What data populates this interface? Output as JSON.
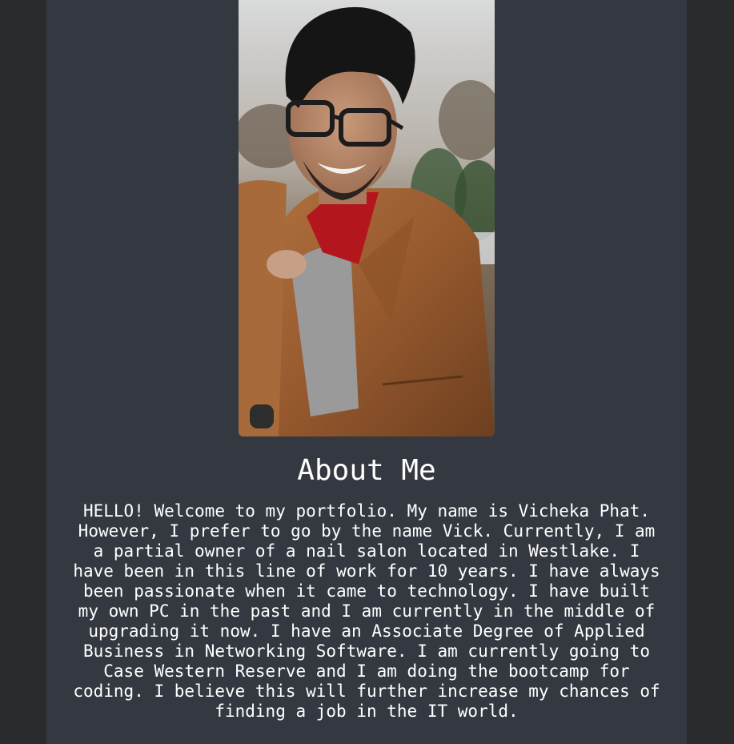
{
  "about": {
    "heading": "About Me",
    "bio": "HELLO! Welcome to my portfolio. My name is Vicheka Phat. However, I prefer to go by the name Vick. Currently, I am a partial owner of a nail salon located in Westlake. I have been in this line of work for 10 years. I have always been passionate when it came to technology. I have built my own PC in the past and I am currently in the middle of upgrading it now. I have an Associate Degree of Applied Business in Networking Software. I am currently going to Case Western Reserve and I am doing the bootcamp for coding. I believe this will further increase my chances of finding a job in the IT world."
  },
  "colors": {
    "page_background": "#2a2b2d",
    "card_background": "#343840",
    "text": "#ffffff"
  },
  "photo": {
    "icon": "profile-photo"
  }
}
